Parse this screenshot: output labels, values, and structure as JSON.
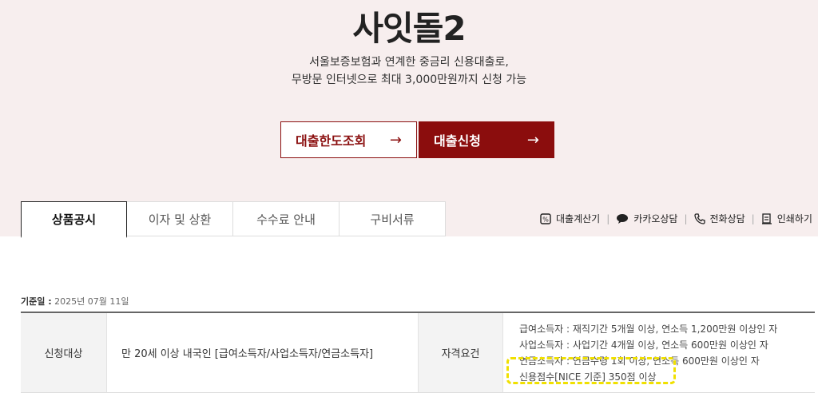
{
  "hero": {
    "title": "사잇돌2",
    "desc_line1": "서울보증보험과 연계한 중금리 신용대출로,",
    "desc_line2": "무방문 인터넷으로 최대 3,000만원까지 신청 가능"
  },
  "buttons": {
    "limit_check": "대출한도조회",
    "apply": "대출신청",
    "arrow": "→"
  },
  "tabs": [
    {
      "label": "상품공시",
      "active": true
    },
    {
      "label": "이자 및 상환",
      "active": false
    },
    {
      "label": "수수료 안내",
      "active": false
    },
    {
      "label": "구비서류",
      "active": false
    }
  ],
  "tools": {
    "calculator": "대출계산기",
    "kakao": "카카오상담",
    "phone": "전화상담",
    "print": "인쇄하기",
    "separator": "|"
  },
  "base_date": {
    "label": "기준일 :",
    "value": "2025년 07월 11일"
  },
  "table": {
    "col1_header": "신청대상",
    "col1_value": "만 20세 이상 내국인 [급여소득자/사업소득자/연금소득자]",
    "col2_header": "자격요건",
    "requirements": [
      "급여소득자 : 재직기간 5개월 이상, 연소득 1,200만원 이상인 자",
      "사업소득자 : 사업기간 4개월 이상, 연소득 600만원 이상인 자",
      "연금소득자 : 연금수령 1회 이상, 연소득 600만원 이상인 자",
      "신용점수[NICE 기준] 350점 이상"
    ]
  },
  "colors": {
    "brand": "#8b0d0d",
    "hero_bg": "#f7eeee",
    "highlight": "#f0e000"
  }
}
